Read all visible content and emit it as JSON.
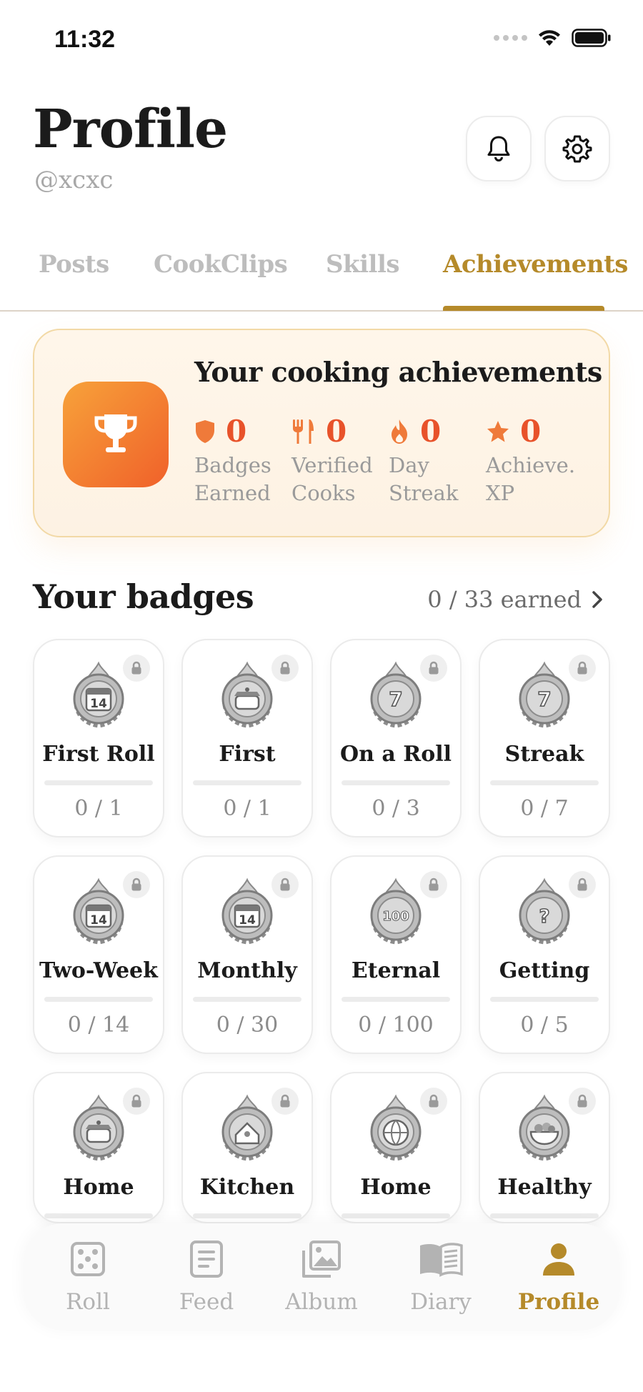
{
  "status_bar": {
    "time": "11:32"
  },
  "header": {
    "title": "Profile",
    "handle": "@xcxc"
  },
  "tabs": [
    {
      "label": "Posts",
      "active": false
    },
    {
      "label": "CookClips",
      "active": false
    },
    {
      "label": "Skills",
      "active": false
    },
    {
      "label": "Achievements",
      "active": true
    }
  ],
  "achievements": {
    "title": "Your cooking achievements",
    "stats": [
      {
        "icon": "shield-icon",
        "value": "0",
        "label": "Badges Earned"
      },
      {
        "icon": "fork-knife-icon",
        "value": "0",
        "label": "Verified Cooks"
      },
      {
        "icon": "flame-icon",
        "value": "0",
        "label": "Day Streak"
      },
      {
        "icon": "star-icon",
        "value": "0",
        "label": "Achieve. XP"
      }
    ]
  },
  "badges_section": {
    "title": "Your badges",
    "earned_label": "0 / 33 earned"
  },
  "badges": [
    {
      "name": "First Roll",
      "progress": "0 / 1",
      "icon": "calendar-14-flame-medal"
    },
    {
      "name": "First Cook",
      "progress": "0 / 1",
      "icon": "cooking-pot-medal"
    },
    {
      "name": "On a Roll",
      "progress": "0 / 3",
      "icon": "number-7-medal"
    },
    {
      "name": "Streak Keeper",
      "progress": "0 / 7",
      "icon": "number-7-medal"
    },
    {
      "name": "Two-Week Flame",
      "progress": "0 / 14",
      "icon": "calendar-14-flame-medal"
    },
    {
      "name": "Monthly Master",
      "progress": "0 / 30",
      "icon": "calendar-14-chef-medal"
    },
    {
      "name": "Eternal Flame",
      "progress": "0 / 100",
      "icon": "number-100-laurel-medal"
    },
    {
      "name": "Getting Started",
      "progress": "0 / 5",
      "icon": "question-mark-medal"
    },
    {
      "name": "Home Cook",
      "progress": "",
      "icon": "cooking-pot-medal"
    },
    {
      "name": "Kitchen Regular",
      "progress": "",
      "icon": "chef-house-medal"
    },
    {
      "name": "Home Chef",
      "progress": "",
      "icon": "globe-medal"
    },
    {
      "name": "Healthy Chef",
      "progress": "",
      "icon": "salad-bowl-medal"
    }
  ],
  "nav": [
    {
      "label": "Roll",
      "icon": "dice-icon",
      "active": false
    },
    {
      "label": "Feed",
      "icon": "feed-icon",
      "active": false
    },
    {
      "label": "Album",
      "icon": "album-icon",
      "active": false
    },
    {
      "label": "Diary",
      "icon": "book-icon",
      "active": false
    },
    {
      "label": "Profile",
      "icon": "person-icon",
      "active": true
    }
  ],
  "colors": {
    "accent": "#b58a2a",
    "stat_number": "#e8522a",
    "stat_icon": "#ef7a3a",
    "trophy_gradient_start": "#f7a23a",
    "trophy_gradient_end": "#f0612a"
  }
}
